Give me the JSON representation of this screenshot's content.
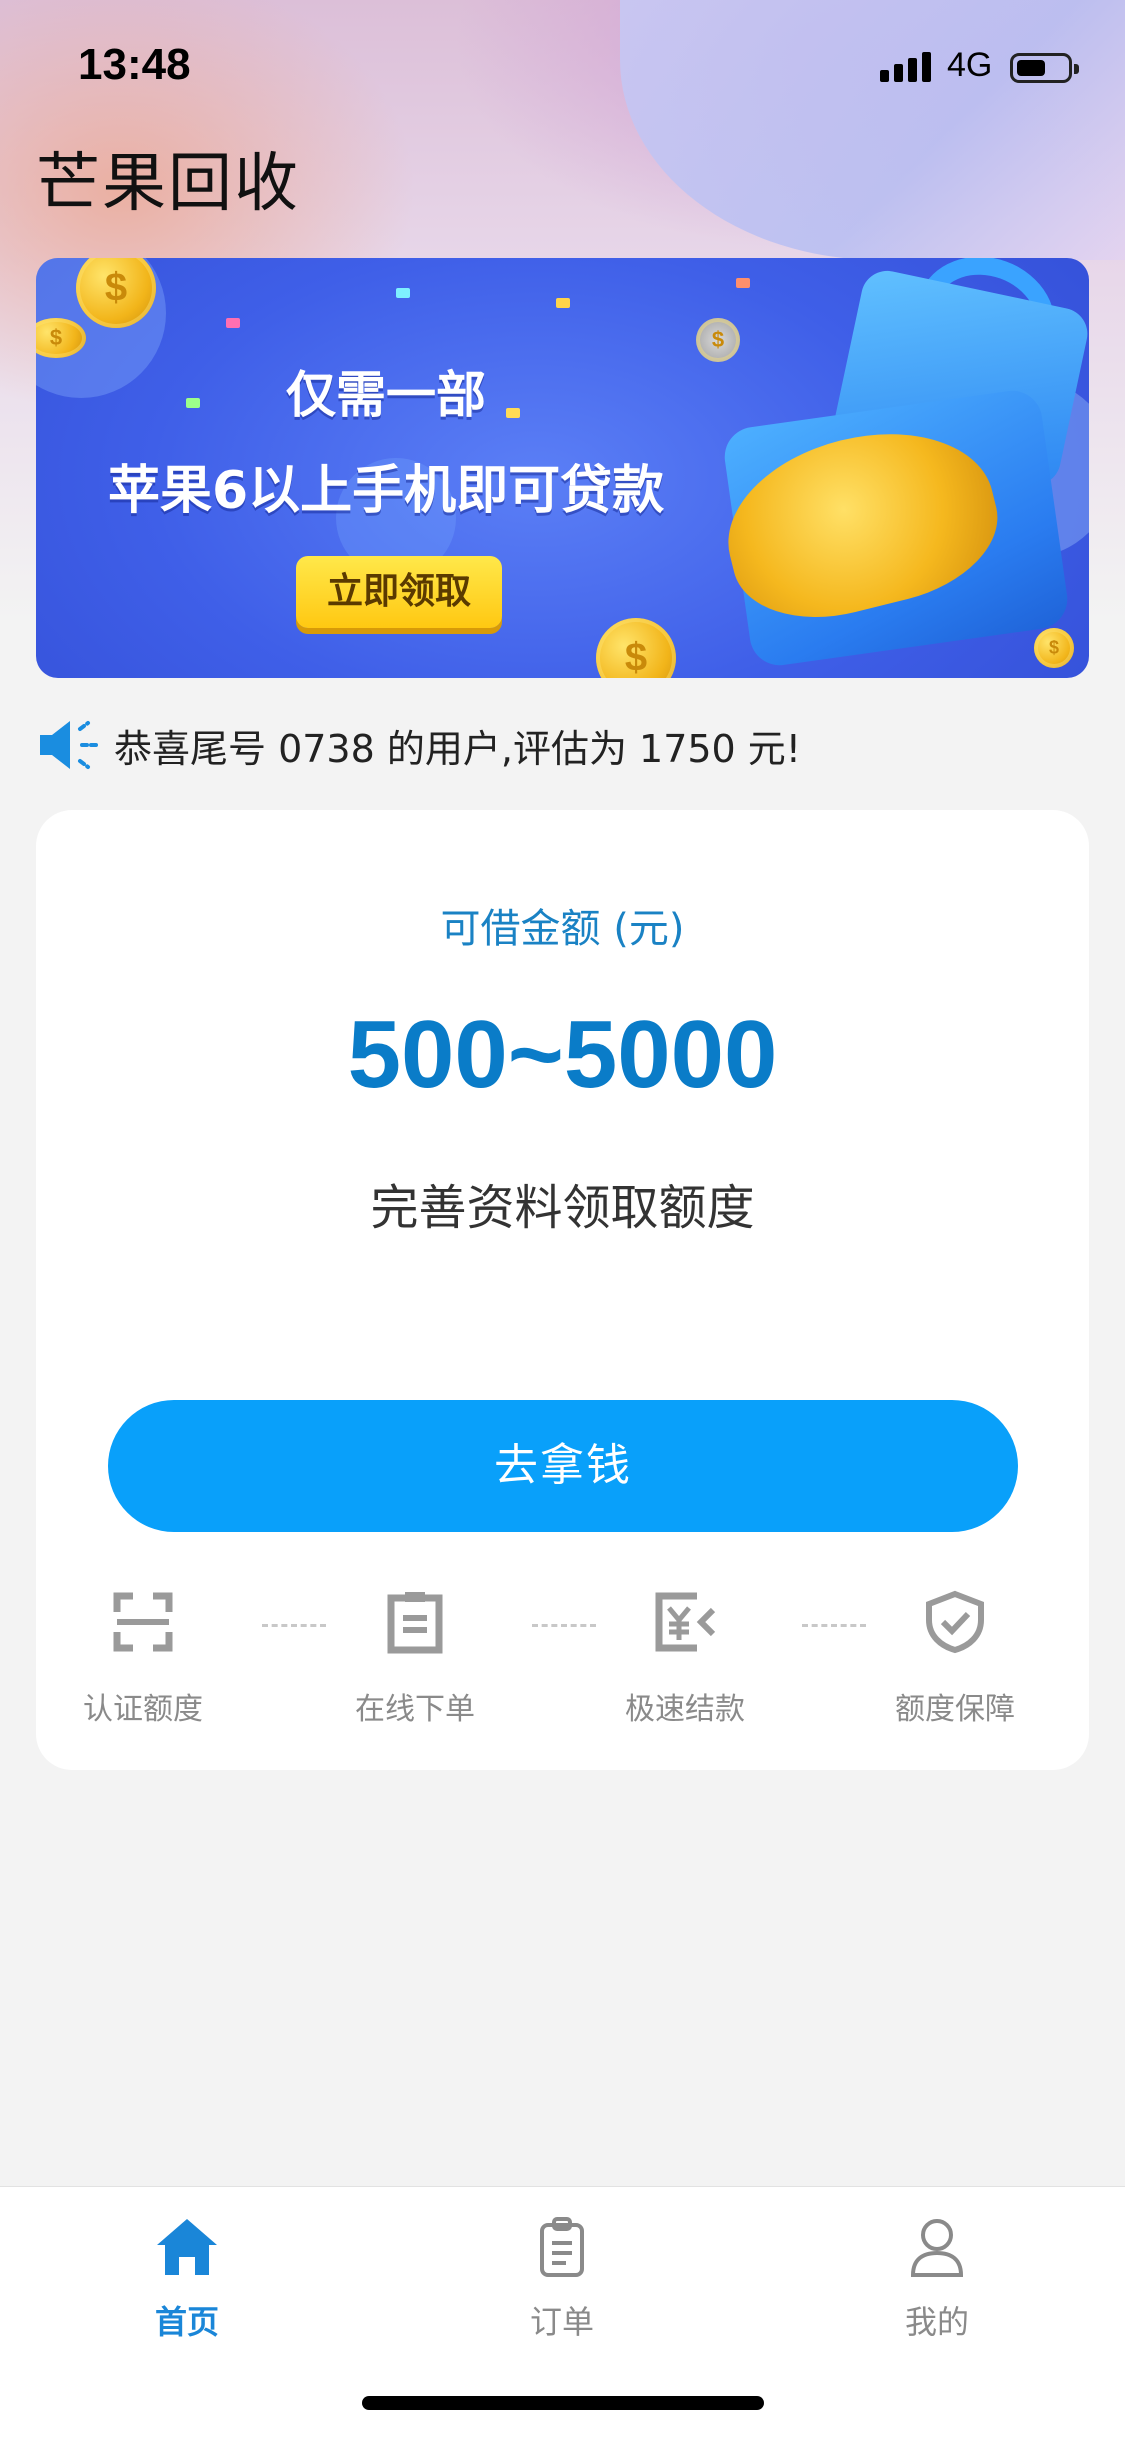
{
  "status_bar": {
    "time": "13:48",
    "network": "4G",
    "battery_level": 0.55
  },
  "app": {
    "title": "芒果回收"
  },
  "banner": {
    "line1": "仅需一部",
    "line2": "苹果6以上手机即可贷款",
    "button_label": "立即领取"
  },
  "notice": {
    "text": "恭喜尾号 0738 的用户,评估为 1750 元!",
    "icon": "speaker-icon"
  },
  "loan_card": {
    "label": "可借金额 (元)",
    "amount": "500~5000",
    "subtitle": "完善资料领取额度",
    "cta_label": "去拿钱"
  },
  "steps": [
    {
      "label": "认证额度",
      "icon": "scan-frame-icon"
    },
    {
      "label": "在线下单",
      "icon": "clipboard-icon"
    },
    {
      "label": "极速结款",
      "icon": "yen-transfer-icon"
    },
    {
      "label": "额度保障",
      "icon": "shield-check-icon"
    }
  ],
  "tabbar": {
    "items": [
      {
        "label": "首页",
        "icon": "home-icon",
        "active": true
      },
      {
        "label": "订单",
        "icon": "clipboard-list-icon",
        "active": false
      },
      {
        "label": "我的",
        "icon": "user-icon",
        "active": false
      }
    ]
  },
  "colors": {
    "accent": "#0a7cc8",
    "button": "#09a0fa",
    "tab_active": "#1a86d8",
    "tab_inactive": "#8a8a8a"
  }
}
